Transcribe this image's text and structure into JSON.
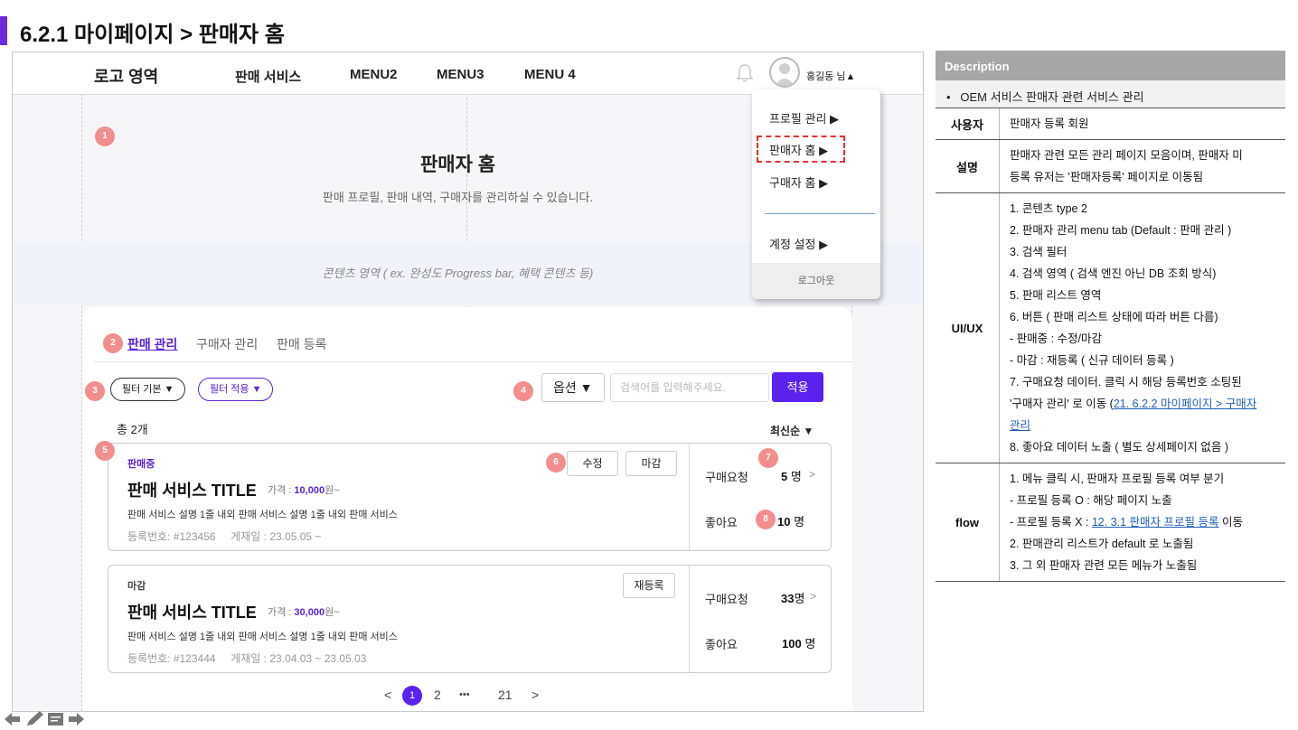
{
  "slide": {
    "title": "6.2.1 마이페이지 > 판매자 홈"
  },
  "nav": {
    "logo": "로고 영역",
    "items": [
      "판매 서비스",
      "MENU2",
      "MENU3",
      "MENU 4"
    ],
    "user_name": "홍길동 님▲"
  },
  "dropdown": {
    "items": [
      "프로필 관리 ▶",
      "판매자 홈  ▶",
      "구매자 홈 ▶",
      "계정 설정 ▶"
    ],
    "logout": "로그아웃"
  },
  "hero": {
    "title": "판매자 홈",
    "subtitle": "판매 프로필, 판매 내역, 구매자를 관리하실 수 있습니다.",
    "content_area": "콘텐츠 영역 ( ex. 완성도 Progress bar, 혜택 콘텐츠 등)"
  },
  "tabs": [
    "판매 관리",
    "구매자 관리",
    "판매 등록"
  ],
  "filters": {
    "basic": "필터 기본 ▼",
    "applied": "필터 적용 ▼"
  },
  "search": {
    "option": "옵션 ▼",
    "placeholder": "검색어를 입력해주세요.",
    "apply": "적용"
  },
  "list": {
    "total": "총 2개",
    "sort": "최신순 ▼",
    "items": [
      {
        "status": "판매중",
        "status_color": "#5a22d6",
        "title": "판매 서비스 TITLE",
        "price_label": "가격 : ",
        "price": "10,000",
        "price_suffix": "원~",
        "desc": "판매 서비스 설명 1줄 내외 판매 서비스 설명 1줄 내외 판매 서비스",
        "reg_no": "등록번호: #123456",
        "posted": "게재일 : 23.05.05 ~",
        "buttons": [
          "수정",
          "마감"
        ],
        "request_label": "구매요청",
        "request_count": "5",
        "like_label": "좋아요",
        "like_count": "10",
        "unit": "명"
      },
      {
        "status": "마감",
        "status_color": "#444444",
        "title": "판매 서비스 TITLE",
        "price_label": "가격 : ",
        "price": "30,000",
        "price_suffix": "원~",
        "desc": "판매 서비스 설명 1줄 내외 판매 서비스 설명 1줄 내외 판매 서비스",
        "reg_no": "등록번호: #123444",
        "posted": "게재일 : 23.04.03 ~ 23.05.03",
        "buttons": [
          "재등록"
        ],
        "request_label": "구매요청",
        "request_count": "33",
        "like_label": "좋아요",
        "like_count": "100",
        "unit": "명"
      }
    ]
  },
  "pagination": {
    "prev": "<",
    "current": "1",
    "next_page": "2",
    "ellipsis": "•••",
    "last": "21",
    "next": ">"
  },
  "badges": [
    "1",
    "2",
    "3",
    "4",
    "5",
    "6",
    "7",
    "8"
  ],
  "description": {
    "header": "Description",
    "bullet": "OEM 서비스 판매자 관련 서비스 관리",
    "rows": [
      {
        "label": "사용자",
        "lines": [
          "판매자 등록 회원"
        ]
      },
      {
        "label": "설명",
        "lines": [
          "판매자 관련 모든 관리 페이지 모음이며, 판매자 미",
          "등록 유저는 '판매자등록' 페이지로 이동됨"
        ]
      },
      {
        "label": "UI/UX",
        "lines": [
          "1. 콘텐츠 type 2",
          "2. 판매자 관리 menu tab (Default : 판매 관리 )",
          "3. 검색 필터",
          "4. 검색 영역 ( 검색 엔진 아닌 DB 조회 방식)",
          "5. 판매 리스트 영역",
          "6. 버튼 ( 판매 리스트 상태에 따라 버튼 다름)",
          "- 판매중 : 수정/마감",
          "- 마감 : 재등록 ( 신규 데이터 등록 )",
          "7. 구매요청 데이터. 클릭 시 해당 등록번호 소팅된",
          "'구매자 관리' 로 이동 (",
          "관리",
          "8.  좋아요 데이터 노출 ( 별도 상세페이지 없음 )"
        ],
        "link": "21. 6.2.2 마이페이지 > 구매자"
      },
      {
        "label": "flow",
        "lines": [
          "1. 메뉴 클릭 시, 판매자 프로필 등록 여부 분기",
          " - 프로필 등록 O : 해당 페이지 노출",
          " - 프로필 등록 X : ",
          " 이동",
          "2. 판매관리 리스트가 default 로 노출됨",
          "3. 그 외 판매자 관련 모든 메뉴가 노출됨"
        ],
        "link": "12. 3.1 판매자 프로필 등록"
      }
    ]
  },
  "icons": [
    "bell-icon",
    "avatar-icon",
    "prev-arrow-icon",
    "pencil-icon",
    "notes-icon",
    "next-arrow-icon"
  ],
  "colors": {
    "accent": "#5a22ee",
    "badge": "#f28e8e",
    "title_bar": "#6b2bd9"
  }
}
